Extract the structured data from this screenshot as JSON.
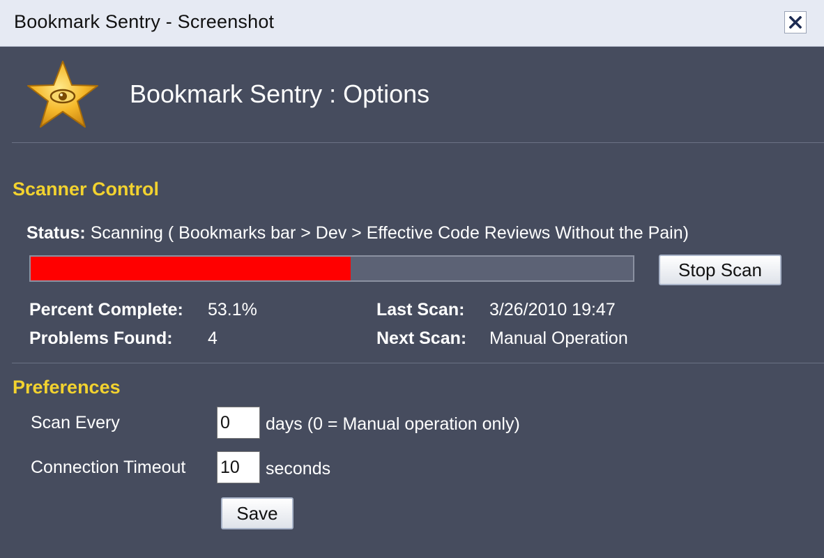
{
  "window": {
    "title": "Bookmark Sentry - Screenshot",
    "close_icon": "close-icon"
  },
  "header": {
    "logo_icon": "star-eye-icon",
    "title": "Bookmark Sentry : Options"
  },
  "scanner": {
    "heading": "Scanner Control",
    "status_label": "Status:",
    "status_value": "Scanning ( Bookmarks bar > Dev > Effective Code Reviews Without the Pain)",
    "progress_percent": 53.1,
    "progress_color": "#ff0000",
    "stop_button_label": "Stop Scan",
    "percent_complete_label": "Percent Complete:",
    "percent_complete_value": "53.1%",
    "problems_found_label": "Problems Found:",
    "problems_found_value": "4",
    "last_scan_label": "Last Scan:",
    "last_scan_value": "3/26/2010 19:47",
    "next_scan_label": "Next Scan:",
    "next_scan_value": "Manual Operation"
  },
  "preferences": {
    "heading": "Preferences",
    "scan_every_label": "Scan Every",
    "scan_every_value": "0",
    "scan_every_suffix": "days (0 = Manual operation only)",
    "timeout_label": "Connection Timeout",
    "timeout_value": "10",
    "timeout_suffix": "seconds",
    "save_button_label": "Save"
  },
  "colors": {
    "background": "#464c5e",
    "heading": "#f2d22f",
    "titlebar": "#e6eaf3"
  }
}
